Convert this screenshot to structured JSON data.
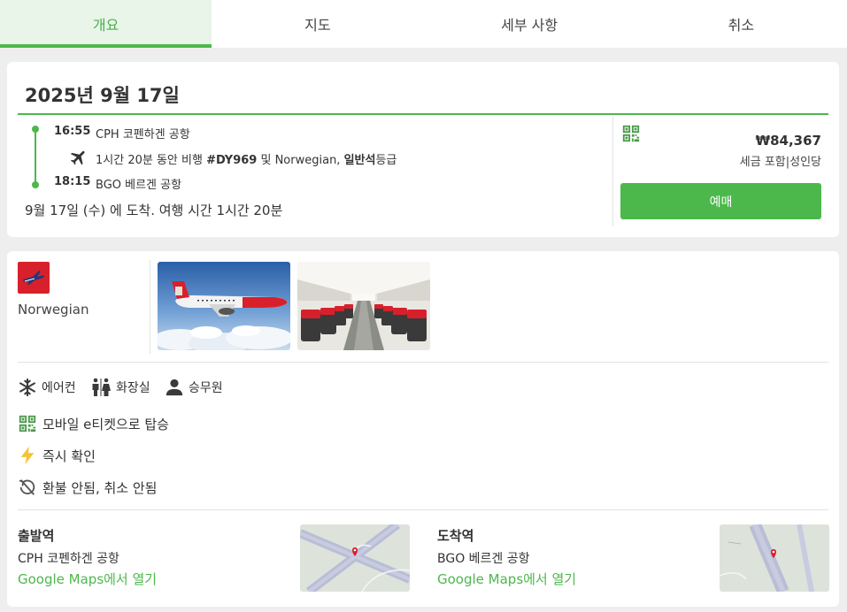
{
  "tabs": [
    {
      "label": "개요",
      "active": true
    },
    {
      "label": "지도"
    },
    {
      "label": "세부 사항"
    },
    {
      "label": "취소"
    }
  ],
  "flight": {
    "date": "2025년 9월 17일",
    "departure": {
      "time": "16:55",
      "airport": "CPH 코펜하겐 공항"
    },
    "segment": {
      "prefix": "1시간 20분 동안 비행 ",
      "flight_no": "#DY969",
      "mid": " 및 Norwegian, ",
      "cabin": "일반석",
      "suffix": "등급"
    },
    "arrival": {
      "time": "18:15",
      "airport": "BGO 베르겐 공항"
    },
    "arrival_note": "9월 17일 (수) 에 도착. 여행 시간 1시간 20분",
    "price": "₩84,367",
    "price_note": "세금 포함|성인당",
    "book_label": "예매"
  },
  "airline": {
    "name": "Norwegian"
  },
  "amenities": [
    {
      "icon": "snowflake-icon",
      "label": "에어컨"
    },
    {
      "icon": "restroom-icon",
      "label": "화장실"
    },
    {
      "icon": "flight-attendant-icon",
      "label": "승무원"
    }
  ],
  "features": [
    {
      "icon": "qr-code-icon",
      "label": "모바일 e티켓으로 탑승"
    },
    {
      "icon": "lightning-icon",
      "label": "즉시 확인"
    },
    {
      "icon": "no-refund-icon",
      "label": "환불 안됨, 취소 안됨"
    }
  ],
  "stations": {
    "departure": {
      "title": "출발역",
      "name": "CPH 코펜하겐 공항",
      "link": "Google Maps에서 열기"
    },
    "arrival": {
      "title": "도착역",
      "name": "BGO 베르겐 공항",
      "link": "Google Maps에서 열기"
    }
  },
  "colors": {
    "accent": "#4cb84c",
    "brand_red": "#d8202c"
  }
}
